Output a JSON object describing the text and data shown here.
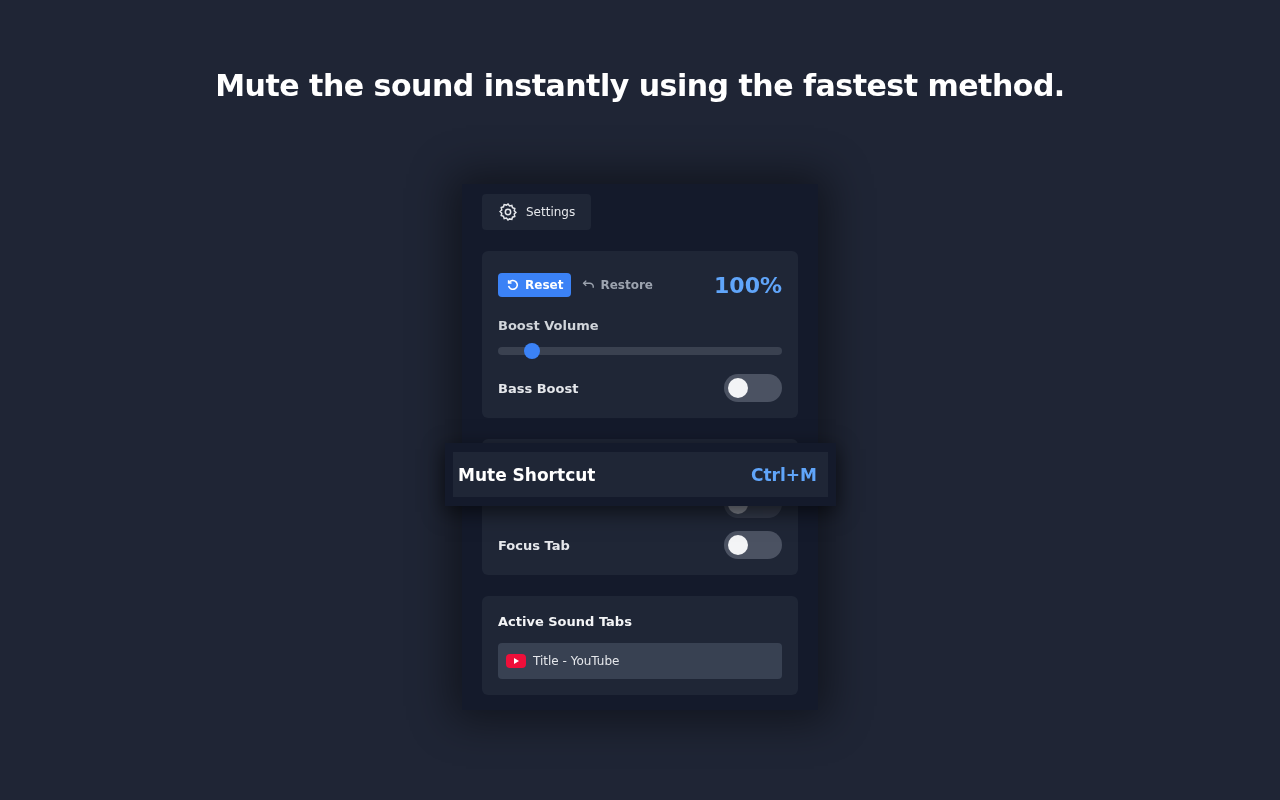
{
  "headline": "Mute the sound instantly using the fastest method.",
  "settings_button": {
    "label": "Settings"
  },
  "volume_card": {
    "reset": {
      "label": "Reset"
    },
    "restore": {
      "label": "Restore"
    },
    "percent": "100%",
    "boost_label": "Boost Volume",
    "boost_slider": {
      "level": 0.12
    },
    "toggles": [
      {
        "label": "Bass Boost",
        "on": false
      }
    ]
  },
  "options_card": {
    "toggles": [
      {
        "on": false
      },
      {
        "label": "Focus Tab",
        "on": false
      }
    ]
  },
  "shortcut_overlay": {
    "label": "Mute Shortcut",
    "keys": "Ctrl+M"
  },
  "active_tabs": {
    "heading": "Active Sound Tabs",
    "tabs": [
      {
        "title": "Title - YouTube"
      }
    ]
  }
}
